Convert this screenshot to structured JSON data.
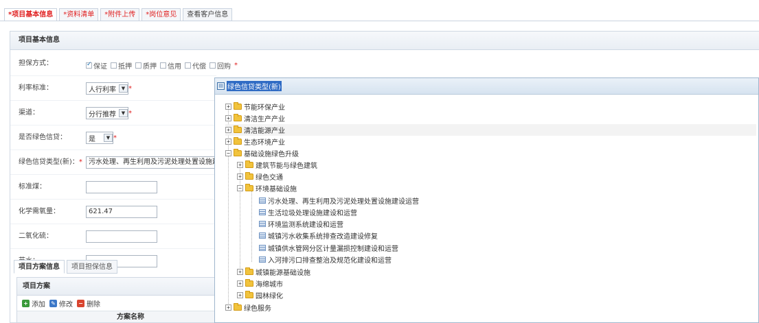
{
  "top_tabs": [
    {
      "label": "项目基本信息",
      "required": true
    },
    {
      "label": "资料清单",
      "required": true
    },
    {
      "label": "附件上传",
      "required": true
    },
    {
      "label": "岗位意见",
      "required": true
    },
    {
      "label": "查看客户信息",
      "required": false
    }
  ],
  "panel": {
    "title": "项目基本信息"
  },
  "form": {
    "guarantee_label": "担保方式：",
    "guarantee_options": [
      {
        "label": "保证",
        "checked": true
      },
      {
        "label": "抵押",
        "checked": false
      },
      {
        "label": "质押",
        "checked": false
      },
      {
        "label": "信用",
        "checked": false
      },
      {
        "label": "代偿",
        "checked": false
      },
      {
        "label": "回购",
        "checked": false
      }
    ],
    "rate_label": "利率标准：",
    "rate_value": "人行利率",
    "channel_label": "渠道：",
    "channel_value": "分行推荐",
    "green_label": "是否绿色信贷：",
    "green_value": "是",
    "green_type_label": "绿色信贷类型(新)：",
    "green_type_value": "污水处理、再生利用及污泥处理处置设施建",
    "std_coal_label": "标准煤：",
    "std_coal_value": "",
    "cod_label": "化学需氧量：",
    "cod_value": "621.47",
    "so2_label": "二氧化硫：",
    "so2_value": "",
    "water_label": "节水：",
    "water_value": "",
    "required_mark": "*"
  },
  "sub_tabs": [
    {
      "label": "项目方案信息",
      "active": true
    },
    {
      "label": "项目担保信息",
      "active": false
    }
  ],
  "plan": {
    "title": "项目方案",
    "add_label": "添加",
    "edit_label": "修改",
    "delete_label": "删除",
    "column_name": "方案名称"
  },
  "popup": {
    "title": "绿色信贷类型(新)",
    "tree": [
      {
        "label": "节能环保产业",
        "type": "folder",
        "level": 0,
        "expanded": false
      },
      {
        "label": "清洁生产产业",
        "type": "folder",
        "level": 0,
        "expanded": false
      },
      {
        "label": "清洁能源产业",
        "type": "folder",
        "level": 0,
        "expanded": false,
        "highlighted": true
      },
      {
        "label": "生态环境产业",
        "type": "folder",
        "level": 0,
        "expanded": false
      },
      {
        "label": "基础设施绿色升级",
        "type": "folder",
        "level": 0,
        "expanded": true
      },
      {
        "label": "建筑节能与绿色建筑",
        "type": "folder",
        "level": 1,
        "expanded": false
      },
      {
        "label": "绿色交通",
        "type": "folder",
        "level": 1,
        "expanded": false
      },
      {
        "label": "环境基础设施",
        "type": "folder",
        "level": 1,
        "expanded": true
      },
      {
        "label": "污水处理、再生利用及污泥处理处置设施建设运营",
        "type": "leaf",
        "level": 2
      },
      {
        "label": "生活垃圾处理设施建设和运营",
        "type": "leaf",
        "level": 2
      },
      {
        "label": "环境监测系统建设和运营",
        "type": "leaf",
        "level": 2
      },
      {
        "label": "城镇污水收集系统排查改造建设修复",
        "type": "leaf",
        "level": 2
      },
      {
        "label": "城镇供水管网分区计量漏损控制建设和运营",
        "type": "leaf",
        "level": 2
      },
      {
        "label": "入河排污口排查整治及规范化建设和运营",
        "type": "leaf",
        "level": 2
      },
      {
        "label": "城镇能源基础设施",
        "type": "folder",
        "level": 1,
        "expanded": false
      },
      {
        "label": "海绵城市",
        "type": "folder",
        "level": 1,
        "expanded": false
      },
      {
        "label": "园林绿化",
        "type": "folder",
        "level": 1,
        "expanded": false
      },
      {
        "label": "绿色服务",
        "type": "folder",
        "level": 0,
        "expanded": false
      }
    ]
  }
}
